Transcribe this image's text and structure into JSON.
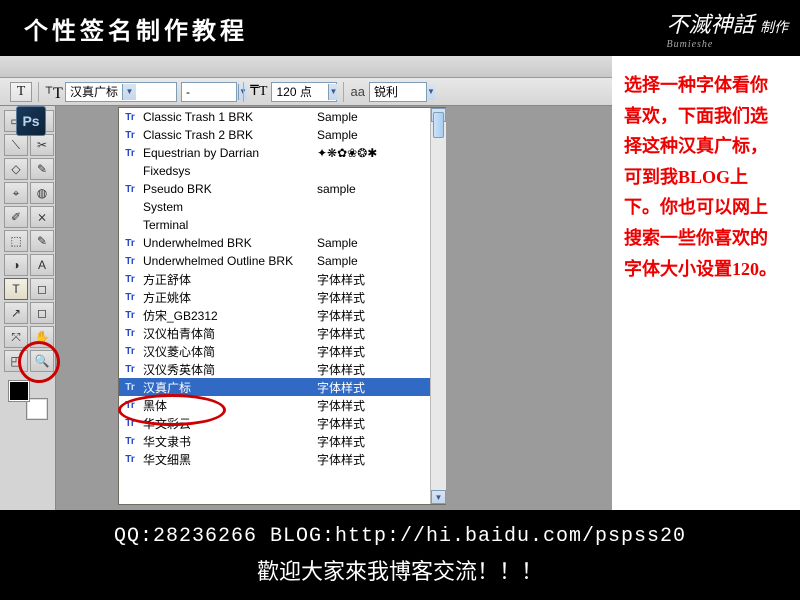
{
  "header": {
    "title": "个性签名制作教程",
    "brand_main": "不滅神話",
    "brand_sub": "Bumieshe"
  },
  "optbar": {
    "font_family": "汉真广标",
    "font_style": "-",
    "font_size": "120 点",
    "aa_label": "aa",
    "aa_mode": "锐利"
  },
  "fonts": [
    {
      "tt": true,
      "name": "Classic Trash 1 BRK",
      "sample": "Sample"
    },
    {
      "tt": true,
      "name": "Classic Trash 2 BRK",
      "sample": "Sample"
    },
    {
      "tt": true,
      "name": "Equestrian by Darrian",
      "sample": "✦❋✿❀❂✱"
    },
    {
      "tt": false,
      "name": "Fixedsys",
      "sample": ""
    },
    {
      "tt": true,
      "name": "Pseudo BRK",
      "sample": "sample"
    },
    {
      "tt": false,
      "name": "System",
      "sample": ""
    },
    {
      "tt": false,
      "name": "Terminal",
      "sample": ""
    },
    {
      "tt": true,
      "name": "Underwhelmed BRK",
      "sample": "Sample"
    },
    {
      "tt": true,
      "name": "Underwhelmed Outline BRK",
      "sample": "Sample"
    },
    {
      "tt": true,
      "name": "方正舒体",
      "sample": "字体样式"
    },
    {
      "tt": true,
      "name": "方正姚体",
      "sample": "字体样式"
    },
    {
      "tt": true,
      "name": "仿宋_GB2312",
      "sample": "字体样式"
    },
    {
      "tt": true,
      "name": "汉仪柏青体简",
      "sample": "字体样式"
    },
    {
      "tt": true,
      "name": "汉仪菱心体简",
      "sample": "字体样式"
    },
    {
      "tt": true,
      "name": "汉仪秀英体简",
      "sample": "字体样式"
    },
    {
      "tt": true,
      "name": "汉真广标",
      "sample": "字体样式",
      "selected": true
    },
    {
      "tt": true,
      "name": "黑体",
      "sample": "字体样式"
    },
    {
      "tt": true,
      "name": "华文彩云",
      "sample": "字体样式"
    },
    {
      "tt": true,
      "name": "华文隶书",
      "sample": "字体样式"
    },
    {
      "tt": true,
      "name": "华文细黑",
      "sample": "字体样式"
    }
  ],
  "note": {
    "text": "选择一种字体看你喜欢，下面我们选择这种汉真广标，可到我BLOG上下。你也可以网上搜索一些你喜欢的字体大小设置120。"
  },
  "footer": {
    "line1": "QQ:28236266  BLOG:http://hi.baidu.com/pspss20",
    "line2": "歡迎大家來我博客交流！！！"
  },
  "ps_logo": "Ps",
  "tools": [
    "▭",
    "↖",
    "⟍",
    "✂",
    "◇",
    "✎",
    "⌖",
    "◍",
    "✐",
    "⨯",
    "⬚",
    "✎",
    "◑",
    "A",
    "T",
    "◻",
    "↗",
    "◻",
    "⤧",
    "✋",
    "◰",
    "🔍"
  ]
}
